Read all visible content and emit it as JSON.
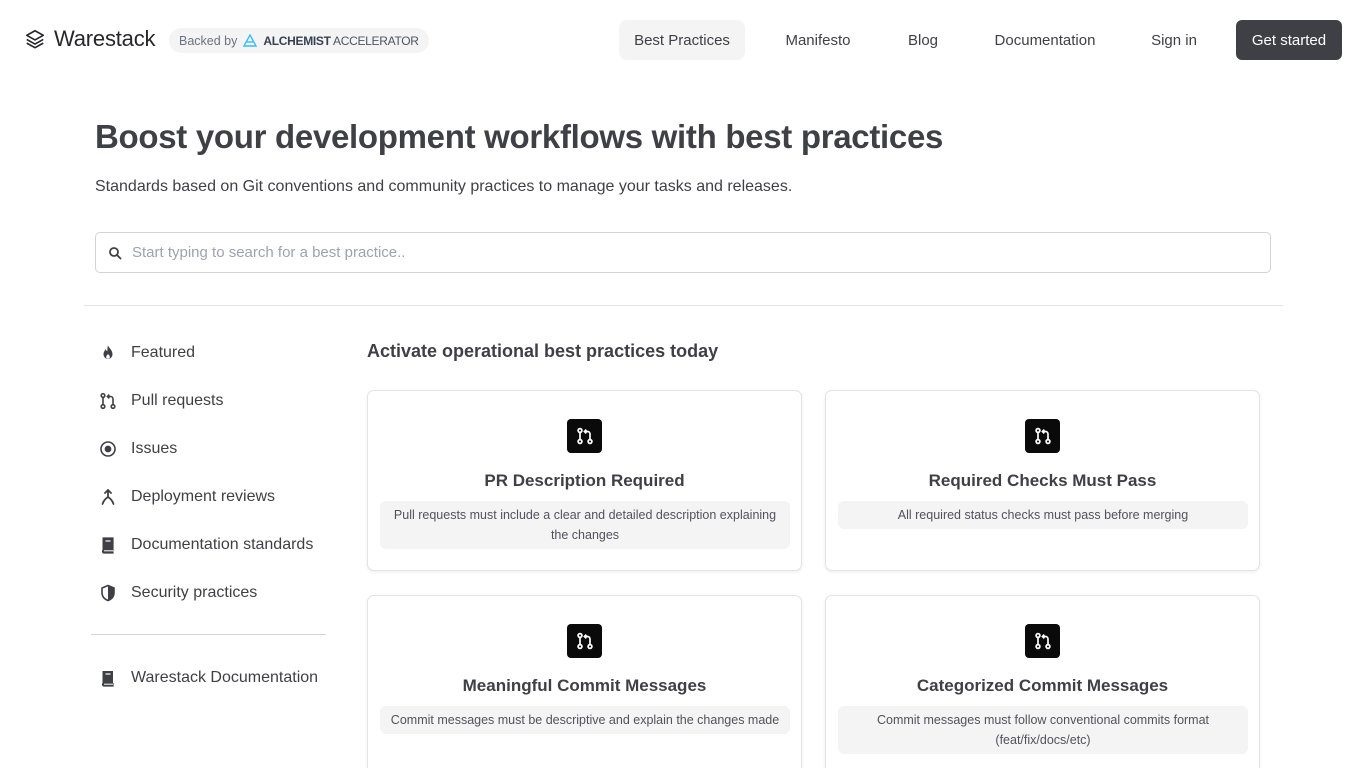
{
  "brand": {
    "name": "Warestack",
    "backed_prefix": "Backed by",
    "backer_bold": "ALCHEMIST",
    "backer_rest": " ACCELERATOR"
  },
  "nav": {
    "items": [
      "Best Practices",
      "Manifesto",
      "Blog",
      "Documentation",
      "Sign in"
    ],
    "active": "Best Practices",
    "cta": "Get started"
  },
  "hero": {
    "title": "Boost your development workflows with best practices",
    "subtitle": "Standards based on Git conventions and community practices to manage your tasks and releases."
  },
  "search": {
    "placeholder": "Start typing to search for a best practice..",
    "value": ""
  },
  "sidebar": {
    "items": [
      {
        "label": "Featured",
        "icon": "flame-icon"
      },
      {
        "label": "Pull requests",
        "icon": "pull-request-icon"
      },
      {
        "label": "Issues",
        "icon": "issue-icon"
      },
      {
        "label": "Deployment reviews",
        "icon": "deploy-icon"
      },
      {
        "label": "Documentation standards",
        "icon": "book-icon"
      },
      {
        "label": "Security practices",
        "icon": "shield-icon"
      }
    ],
    "footer_item": {
      "label": "Warestack Documentation",
      "icon": "book-icon"
    }
  },
  "main": {
    "section_title": "Activate operational best practices today",
    "cards": [
      {
        "title": "PR Description Required",
        "description": "Pull requests must include a clear and detailed description explaining the changes",
        "icon": "pull-request-icon"
      },
      {
        "title": "Required Checks Must Pass",
        "description": "All required status checks must pass before merging",
        "icon": "pull-request-icon"
      },
      {
        "title": "Meaningful Commit Messages",
        "description": "Commit messages must be descriptive and explain the changes made",
        "icon": "pull-request-icon"
      },
      {
        "title": "Categorized Commit Messages",
        "description": "Commit messages must follow conventional commits format (feat/fix/docs/etc)",
        "icon": "pull-request-icon"
      }
    ]
  },
  "colors": {
    "text": "#3f3f46",
    "cta_bg": "#3f3f46",
    "active_nav_bg": "#f4f4f5",
    "badge_bg": "#0a0a0a",
    "desc_bg": "#f4f4f5"
  }
}
